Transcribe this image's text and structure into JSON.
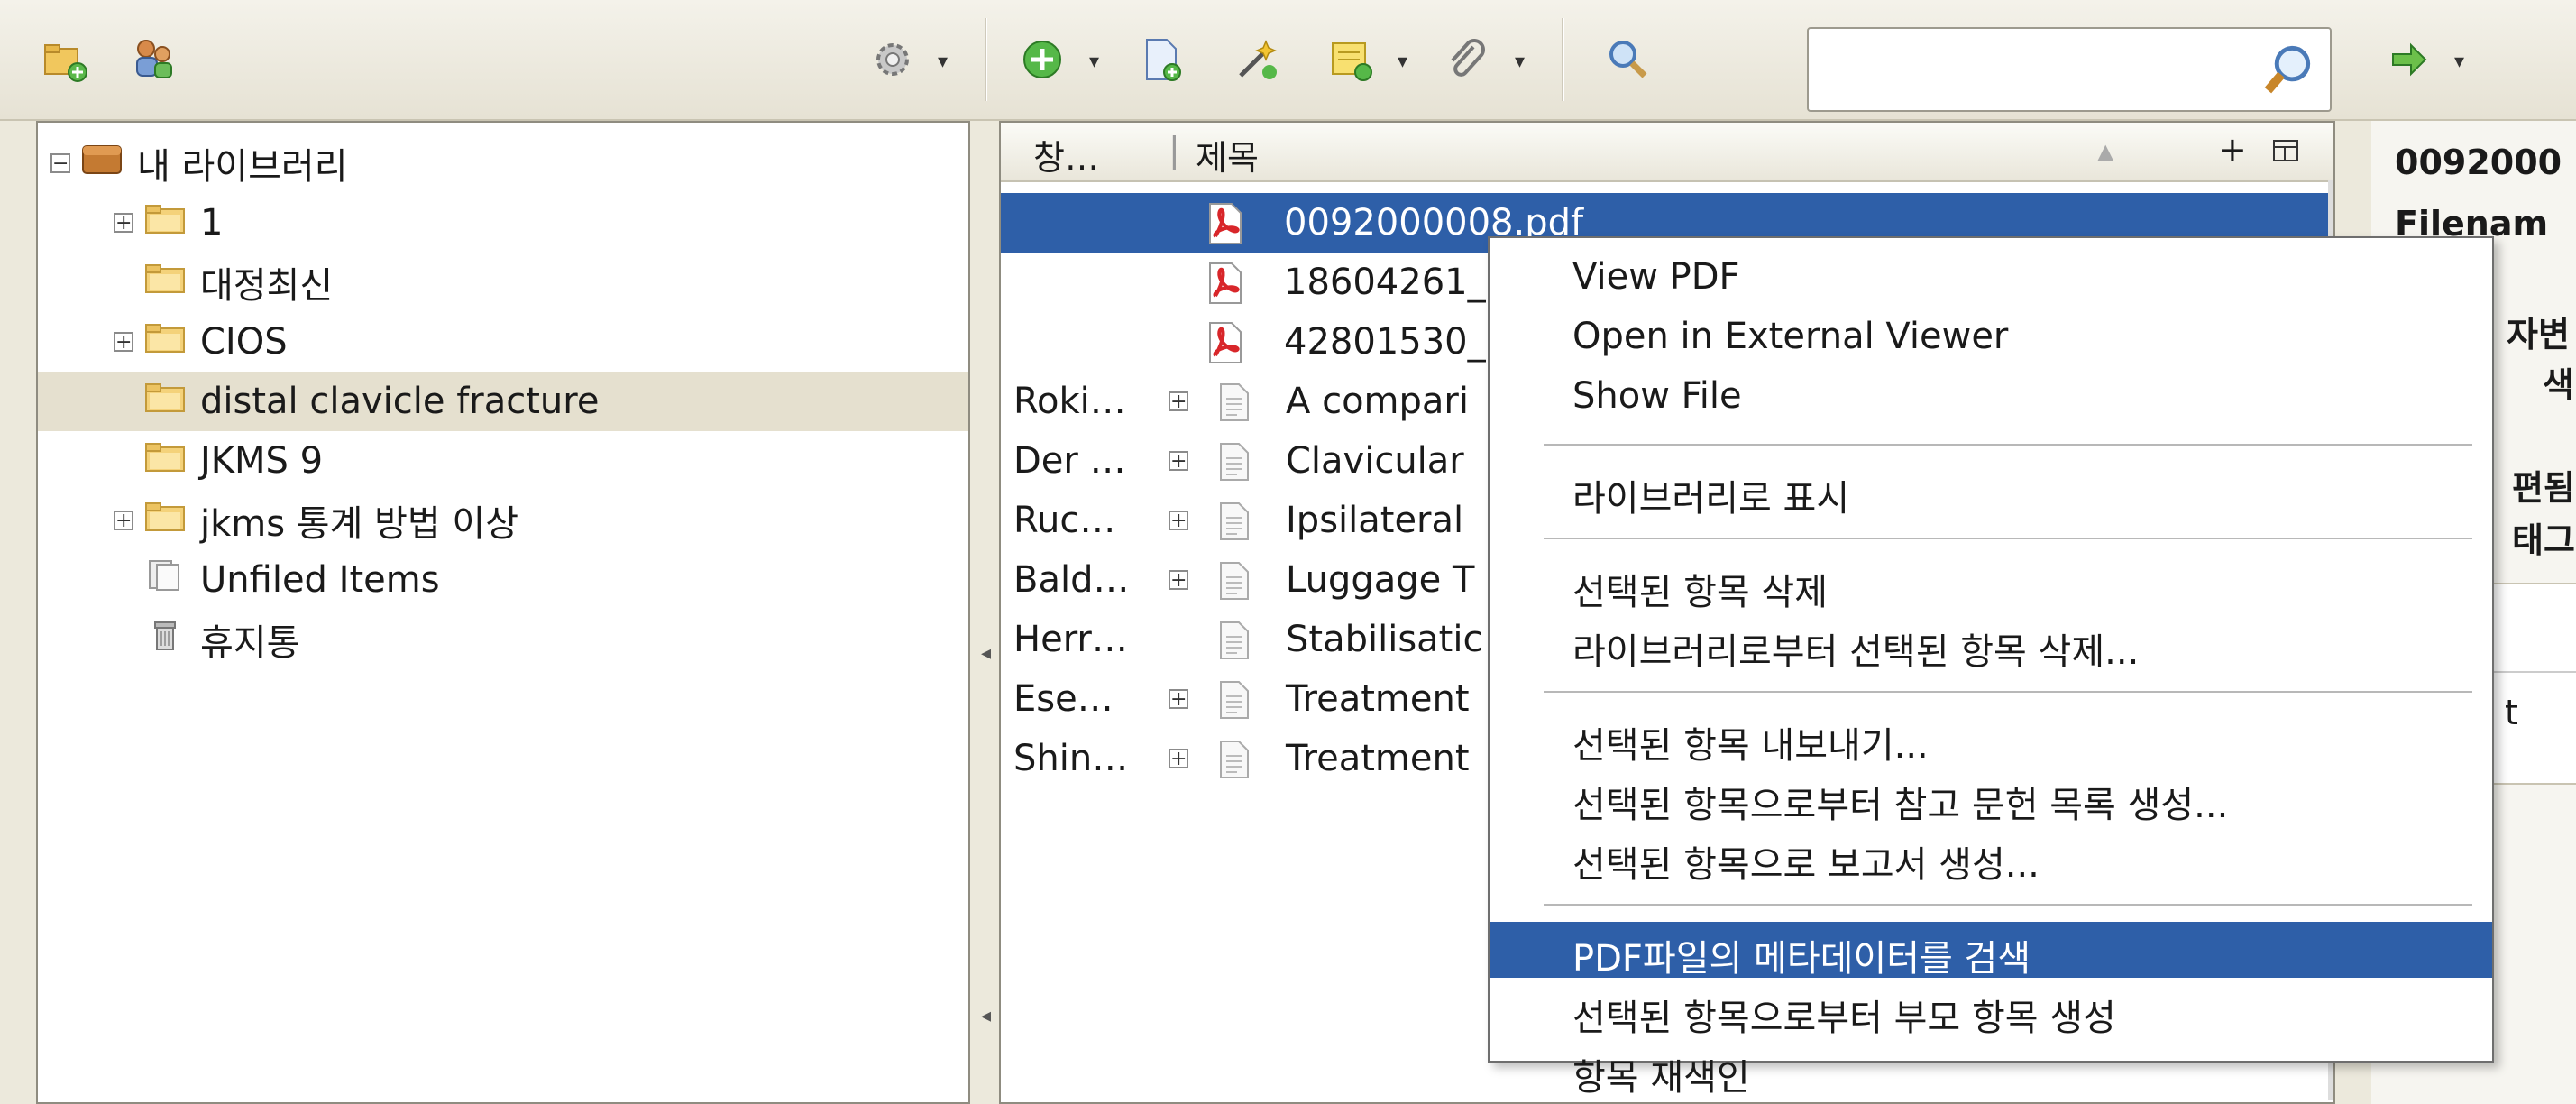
{
  "search": {
    "value": "",
    "placeholder": ""
  },
  "tree": [
    {
      "label": "내 라이브러리",
      "expander": "⊟",
      "icon": "library-icon",
      "indent": 0
    },
    {
      "label": "1",
      "expander": "+",
      "icon": "folder-icon",
      "indent": 1
    },
    {
      "label": "대정최신",
      "expander": "",
      "icon": "folder-icon",
      "indent": 1
    },
    {
      "label": "CIOS",
      "expander": "+",
      "icon": "folder-icon",
      "indent": 1
    },
    {
      "label": "distal clavicle fracture",
      "expander": "",
      "icon": "folder-icon",
      "indent": 1,
      "selected": true
    },
    {
      "label": "JKMS 9",
      "expander": "",
      "icon": "folder-icon",
      "indent": 1
    },
    {
      "label": "jkms 통계 방법 이상",
      "expander": "+",
      "icon": "folder-icon",
      "indent": 1
    },
    {
      "label": "Unfiled Items",
      "expander": "",
      "icon": "unfiled-icon",
      "indent": 1
    },
    {
      "label": "휴지통",
      "expander": "",
      "icon": "trash-icon",
      "indent": 1
    }
  ],
  "list": {
    "columns": {
      "creator": "창…",
      "title": "제목",
      "add": "+"
    },
    "rows": [
      {
        "creator": "",
        "title": "0092000008.pdf",
        "type": "pdf",
        "expander": false,
        "selected": true
      },
      {
        "creator": "",
        "title": "18604261_p",
        "type": "pdf",
        "expander": false
      },
      {
        "creator": "",
        "title": "42801530_p",
        "type": "pdf",
        "expander": false
      },
      {
        "creator": "Roki…",
        "title": "A compari",
        "type": "doc",
        "expander": true
      },
      {
        "creator": "Der …",
        "title": "Clavicular",
        "type": "doc",
        "expander": true
      },
      {
        "creator": "Ruc…",
        "title": "Ipsilateral",
        "type": "doc",
        "expander": true
      },
      {
        "creator": "Bald…",
        "title": "Luggage T",
        "type": "doc",
        "expander": true
      },
      {
        "creator": "Herr…",
        "title": "Stabilisatic",
        "type": "doc",
        "expander": false
      },
      {
        "creator": "Ese…",
        "title": "Treatment",
        "type": "doc",
        "expander": true
      },
      {
        "creator": "Shin…",
        "title": "Treatment",
        "type": "doc",
        "expander": true
      }
    ]
  },
  "context_menu": {
    "groups": [
      [
        "View PDF",
        "Open in External Viewer",
        "Show File"
      ],
      [
        "라이브러리로 표시"
      ],
      [
        "선택된 항목 삭제",
        "라이브러리로부터 선택된 항목 삭제..."
      ],
      [
        "선택된 항목 내보내기...",
        "선택된 항목으로부터 참고 문헌 목록 생성...",
        "선택된 항목으로 보고서 생성..."
      ],
      [
        "PDF파일의 메타데이터를 검색",
        "선택된 항목으로부터 부모 항목 생성",
        "항목 재색인"
      ]
    ],
    "highlighted": "PDF파일의 메타데이터를 검색"
  },
  "right_pane": {
    "lines": [
      "0092000",
      "Filenam",
      "자변",
      "색",
      "편됨",
      "태그",
      "t"
    ]
  }
}
